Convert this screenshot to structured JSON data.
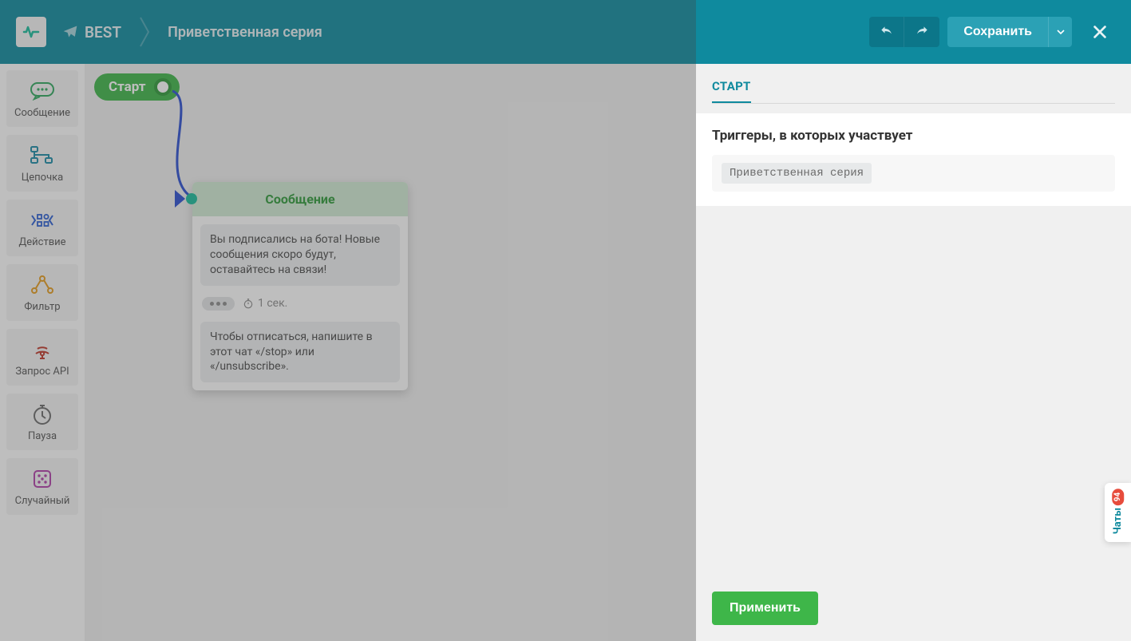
{
  "header": {
    "bot_name": "BEST",
    "flow_title": "Приветственная серия",
    "save_label": "Сохранить"
  },
  "palette": {
    "items": [
      {
        "label": "Сообщение",
        "icon": "message-icon",
        "color": "#2fa85e"
      },
      {
        "label": "Цепочка",
        "icon": "chain-icon",
        "color": "#1b8aa6"
      },
      {
        "label": "Действие",
        "icon": "action-icon",
        "color": "#2a5fd3"
      },
      {
        "label": "Фильтр",
        "icon": "filter-icon",
        "color": "#e59b1e"
      },
      {
        "label": "Запрос API",
        "icon": "api-icon",
        "color": "#c0392b"
      },
      {
        "label": "Пауза",
        "icon": "pause-icon",
        "color": "#6b6b6b"
      },
      {
        "label": "Случайный",
        "icon": "random-icon",
        "color": "#b13fa9"
      }
    ]
  },
  "canvas": {
    "start": {
      "label": "Старт"
    },
    "message_node": {
      "title": "Сообщение",
      "bubble1": "Вы подписались на бота! Новые сообщения скоро будут, оставайтесь на связи!",
      "typing_delay": "1 сек.",
      "bubble2": "Чтобы отписаться, напишите в этот чат «/stop» или «/unsubscribe»."
    }
  },
  "side_panel": {
    "tab_label": "СТАРТ",
    "section_title": "Триггеры, в которых участвует",
    "trigger_name": "Приветственная серия",
    "apply_label": "Применить"
  },
  "chat_tab": {
    "label": "Чаты",
    "badge": "94"
  },
  "colors": {
    "teal": "#0f8a9e",
    "green": "#3eb649",
    "connector": "#2b4fd1"
  }
}
